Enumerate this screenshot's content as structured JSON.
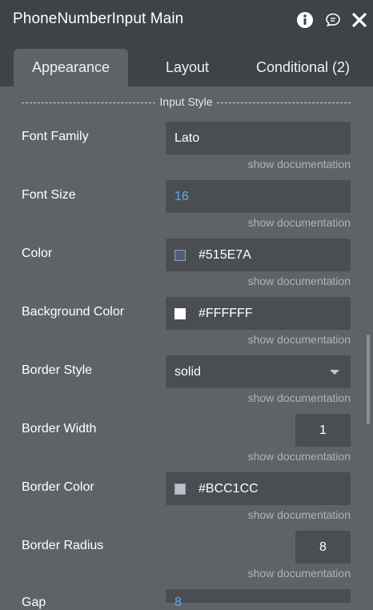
{
  "window": {
    "title": "PhoneNumberInput Main",
    "icons": [
      "info-icon",
      "comment-icon",
      "close-icon"
    ]
  },
  "tabs": [
    {
      "label": "Appearance",
      "active": true
    },
    {
      "label": "Layout",
      "active": false
    },
    {
      "label": "Conditional (2)",
      "active": false
    }
  ],
  "section": {
    "title": "Input Style"
  },
  "fields": {
    "font_family": {
      "label": "Font Family",
      "value": "Lato",
      "docs": "show documentation"
    },
    "font_size": {
      "label": "Font Size",
      "value": "16",
      "docs": "show documentation"
    },
    "color": {
      "label": "Color",
      "value": "#515E7A",
      "swatch": "#515E7A",
      "docs": "show documentation"
    },
    "background_color": {
      "label": "Background Color",
      "value": "#FFFFFF",
      "swatch": "#FFFFFF",
      "docs": "show documentation"
    },
    "border_style": {
      "label": "Border Style",
      "value": "solid",
      "docs": "show documentation"
    },
    "border_width": {
      "label": "Border Width",
      "value": "1",
      "docs": "show documentation"
    },
    "border_color": {
      "label": "Border Color",
      "value": "#BCC1CC",
      "swatch": "#BCC1CC",
      "docs": "show documentation"
    },
    "border_radius": {
      "label": "Border Radius",
      "value": "8",
      "docs": "show documentation"
    }
  },
  "partial_row": {
    "label": "Gap",
    "value": "8"
  },
  "colors": {
    "panel_bg": "#5f6367",
    "header_bg": "#3f4347",
    "field_bg": "#4a4e52",
    "number_text": "#6aa6e9"
  }
}
